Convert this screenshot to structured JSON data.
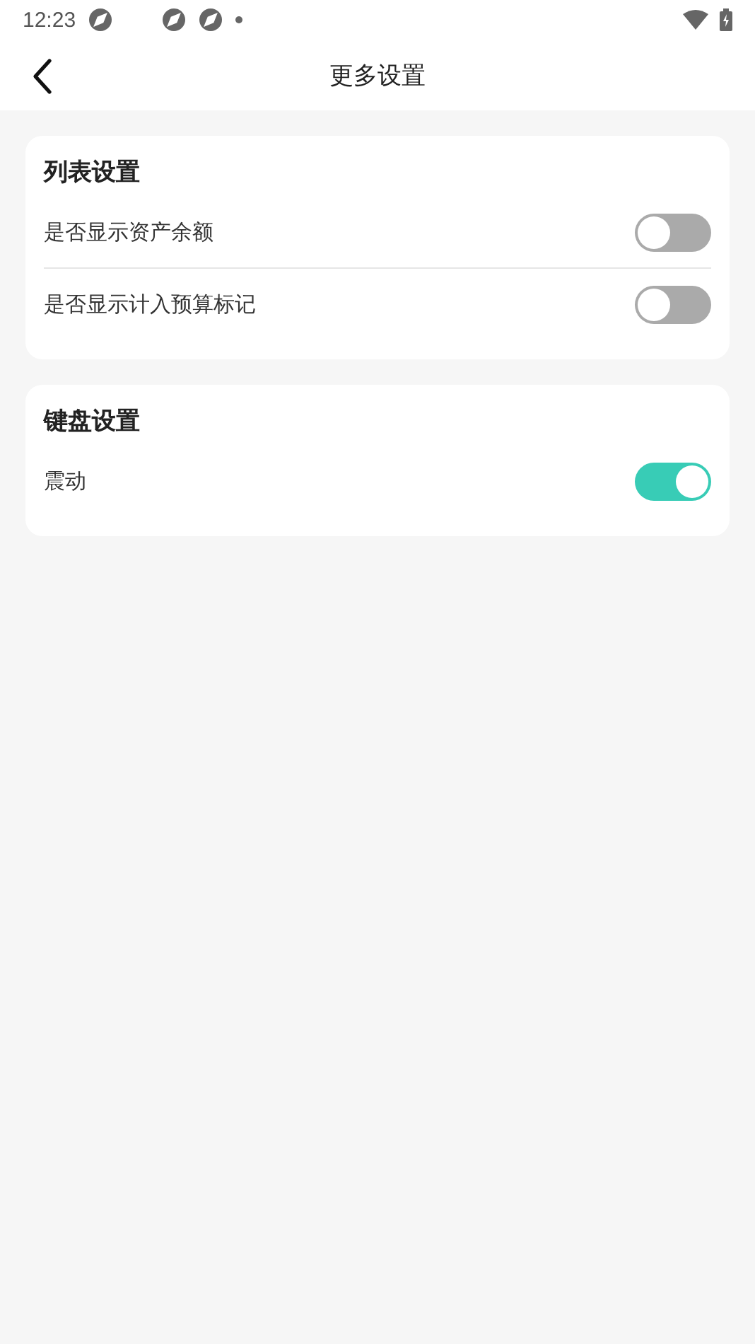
{
  "status_bar": {
    "time": "12:23"
  },
  "header": {
    "title": "更多设置"
  },
  "sections": [
    {
      "title": "列表设置",
      "items": [
        {
          "label": "是否显示资产余额",
          "on": false
        },
        {
          "label": "是否显示计入预算标记",
          "on": false
        }
      ]
    },
    {
      "title": "键盘设置",
      "items": [
        {
          "label": "震动",
          "on": true
        }
      ]
    }
  ]
}
